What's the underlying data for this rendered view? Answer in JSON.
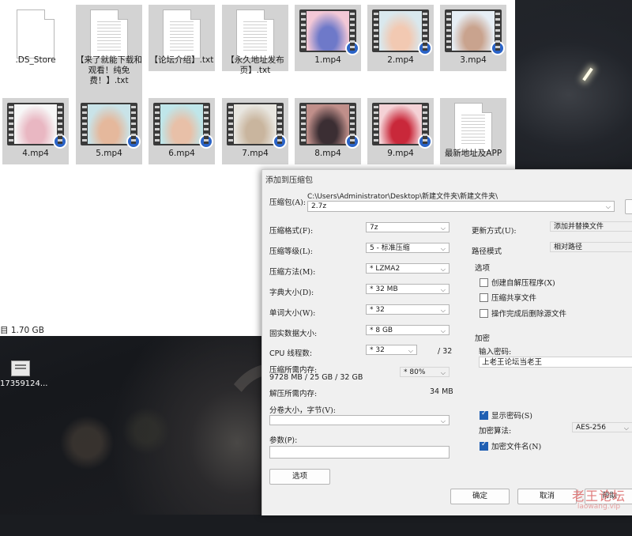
{
  "explorer": {
    "files": [
      {
        "name": ".DS_Store",
        "type": "doc-blank"
      },
      {
        "name": "【来了就能下载和观看！纯免费！】.txt",
        "type": "doc"
      },
      {
        "name": "【论坛介绍】.txt",
        "type": "doc"
      },
      {
        "name": "【永久地址发布页】.txt",
        "type": "doc"
      },
      {
        "name": "1.mp4",
        "type": "video"
      },
      {
        "name": "2.mp4",
        "type": "video"
      },
      {
        "name": "3.mp4",
        "type": "video"
      },
      {
        "name": "4.mp4",
        "type": "video"
      },
      {
        "name": "5.mp4",
        "type": "video"
      },
      {
        "name": "6.mp4",
        "type": "video"
      },
      {
        "name": "7.mp4",
        "type": "video"
      },
      {
        "name": "8.mp4",
        "type": "video"
      },
      {
        "name": "9.mp4",
        "type": "video"
      },
      {
        "name": "最新地址及APP",
        "type": "doc"
      }
    ],
    "status": "目 1.70 GB"
  },
  "desktop": {
    "icon_label": "17359124..."
  },
  "dialog": {
    "title": "添加到压缩包",
    "archive_label": "压缩包(A):",
    "archive_path": "C:\\Users\\Administrator\\Desktop\\新建文件夹\\新建文件夹\\",
    "archive_name": "2.7z",
    "left": {
      "format_label": "压缩格式(F):",
      "format_value": "7z",
      "level_label": "压缩等级(L):",
      "level_value": "5 - 标准压缩",
      "method_label": "压缩方法(M):",
      "method_value": "* LZMA2",
      "dict_label": "字典大小(D):",
      "dict_value": "* 32 MB",
      "word_label": "单词大小(W):",
      "word_value": "* 32",
      "solid_label": "固实数据大小:",
      "solid_value": "* 8 GB",
      "cpu_label": "CPU 线程数:",
      "cpu_value": "* 32",
      "cpu_total": "/ 32",
      "mem_label": "压缩所需内存:",
      "mem_value": "9728 MB / 25 GB / 32 GB",
      "mem_percent": "* 80%",
      "decomp_label": "解压所需内存:",
      "decomp_value": "34 MB",
      "split_label": "分卷大小，字节(V):",
      "params_label": "参数(P):",
      "options_button": "选项"
    },
    "right": {
      "update_label": "更新方式(U):",
      "update_value": "添加并替换文件",
      "path_label": "路径模式",
      "path_value": "相对路径",
      "options_group": "选项",
      "opt_sfx": "创建自解压程序(X)",
      "opt_shared": "压缩共享文件",
      "opt_delete": "操作完成后删除源文件",
      "encrypt_group": "加密",
      "pwd_label": "输入密码:",
      "pwd_value": "上老王论坛当老王",
      "show_pwd": "显示密码(S)",
      "enc_method_label": "加密算法:",
      "enc_method_value": "AES-256",
      "enc_names": "加密文件名(N)"
    },
    "buttons": {
      "ok": "确定",
      "cancel": "取消",
      "help": "帮助"
    }
  },
  "watermark": {
    "text": "老王论坛",
    "url": "laowang.vip"
  }
}
